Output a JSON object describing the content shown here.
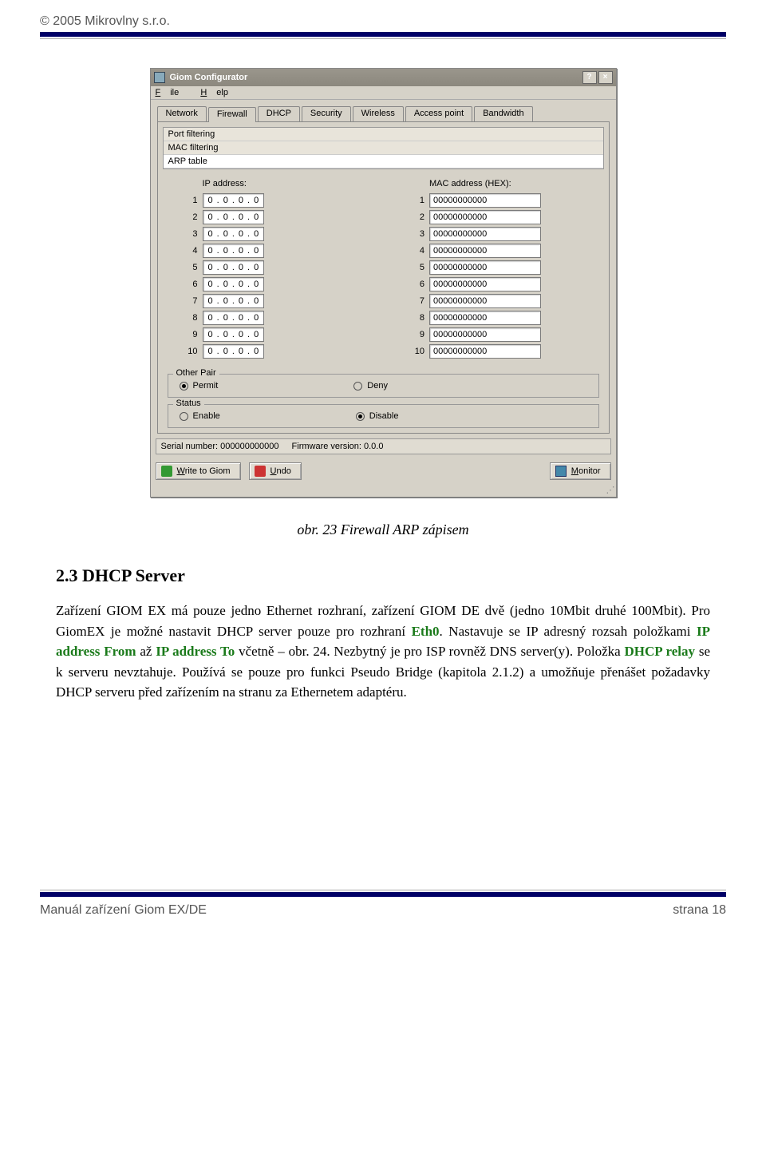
{
  "header": {
    "copyright": "© 2005 Mikrovlny  s.r.o."
  },
  "window": {
    "title": "Giom Configurator",
    "menu": {
      "file": "File",
      "help": "Help"
    },
    "tabs": [
      "Network",
      "Firewall",
      "DHCP",
      "Security",
      "Wireless",
      "Access point",
      "Bandwidth"
    ],
    "active_tab": 1,
    "subtabs": [
      "Port filtering",
      "MAC filtering",
      "ARP table"
    ],
    "active_subtab": 2,
    "ip_header": "IP address:",
    "mac_header": "MAC address (HEX):",
    "rows": [
      {
        "n": "1",
        "ip": [
          "0",
          "0",
          "0",
          "0"
        ],
        "mac": "00000000000"
      },
      {
        "n": "2",
        "ip": [
          "0",
          "0",
          "0",
          "0"
        ],
        "mac": "00000000000"
      },
      {
        "n": "3",
        "ip": [
          "0",
          "0",
          "0",
          "0"
        ],
        "mac": "00000000000"
      },
      {
        "n": "4",
        "ip": [
          "0",
          "0",
          "0",
          "0"
        ],
        "mac": "00000000000"
      },
      {
        "n": "5",
        "ip": [
          "0",
          "0",
          "0",
          "0"
        ],
        "mac": "00000000000"
      },
      {
        "n": "6",
        "ip": [
          "0",
          "0",
          "0",
          "0"
        ],
        "mac": "00000000000"
      },
      {
        "n": "7",
        "ip": [
          "0",
          "0",
          "0",
          "0"
        ],
        "mac": "00000000000"
      },
      {
        "n": "8",
        "ip": [
          "0",
          "0",
          "0",
          "0"
        ],
        "mac": "00000000000"
      },
      {
        "n": "9",
        "ip": [
          "0",
          "0",
          "0",
          "0"
        ],
        "mac": "00000000000"
      },
      {
        "n": "10",
        "ip": [
          "0",
          "0",
          "0",
          "0"
        ],
        "mac": "00000000000"
      }
    ],
    "other_pair": {
      "legend": "Other Pair",
      "permit": "Permit",
      "deny": "Deny",
      "selected": "permit"
    },
    "status_group": {
      "legend": "Status",
      "enable": "Enable",
      "disable": "Disable",
      "selected": "disable"
    },
    "statusbar": {
      "serial_label": "Serial number:",
      "serial": "000000000000",
      "fw_label": "Firmware version:",
      "fw": "0.0.0"
    },
    "buttons": {
      "write": "Write to Giom",
      "undo": "Undo",
      "monitor": "Monitor"
    }
  },
  "caption": "obr. 23 Firewall ARP zápisem",
  "section": {
    "heading": "2.3 DHCP Server",
    "p1_a": "Zařízení GIOM EX má pouze jedno Ethernet rozhraní, zařízení GIOM DE dvě  (jedno 10Mbit druhé 100Mbit). Pro GiomEX je možné nastavit DHCP server pouze pro rozhraní  ",
    "p1_eth": "Eth0",
    "p1_b": ". Nastavuje se IP adresný rozsah položkami ",
    "p1_from": "IP address From",
    "p1_c": " až ",
    "p1_to": "IP address To",
    "p1_d": " včetně – obr. 24. Nezbytný je pro ISP rovněž DNS server(y). Položka ",
    "p1_relay": "DHCP relay",
    "p1_e": " se k serveru nevztahuje. Používá se pouze pro  funkci  Pseudo Bridge (kapitola 2.1.2)  a umožňuje  přenášet požadavky DHCP serveru před zařízením na stranu za Ethernetem adaptéru."
  },
  "footer": {
    "left": "Manuál zařízení Giom EX/DE",
    "right": "strana 18"
  }
}
